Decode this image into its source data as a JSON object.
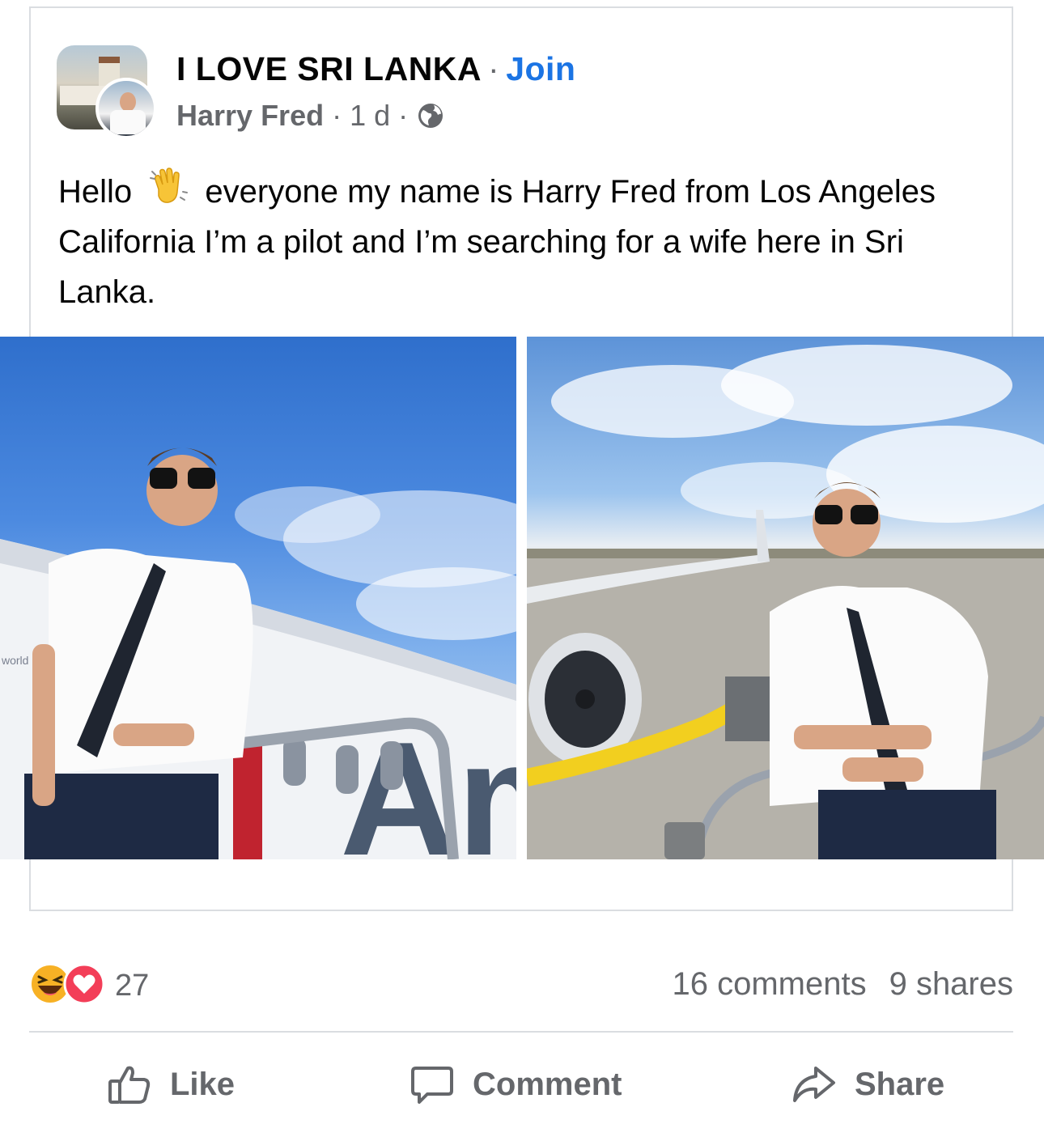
{
  "post": {
    "group_name": "I LOVE SRI LANKA",
    "separator": "·",
    "join_label": "Join",
    "author": "Harry Fred",
    "time": "1 d",
    "text_before_emoji": "Hello",
    "text_after_emoji": "everyone my name is Harry Fred from Los Angeles California I’m a pilot and I’m searching for a wife here in Sri Lanka."
  },
  "photos": [
    {
      "name": "photo-pilot-1"
    },
    {
      "name": "photo-pilot-2"
    }
  ],
  "photo_text": {
    "left_plane_word": "world",
    "left_livery": "Am"
  },
  "stats": {
    "reaction_count": "27",
    "comments": "16 comments",
    "shares": "9 shares"
  },
  "actions": {
    "like": "Like",
    "comment": "Comment",
    "share": "Share"
  },
  "icons": {
    "privacy": "globe-icon",
    "reactions": [
      "haha-reaction-icon",
      "love-reaction-icon"
    ],
    "wave": "waving-hand-emoji"
  },
  "colors": {
    "join": "#1b74e4",
    "secondary_text": "#65676b",
    "love": "#f33e58",
    "haha": "#f7b125"
  }
}
